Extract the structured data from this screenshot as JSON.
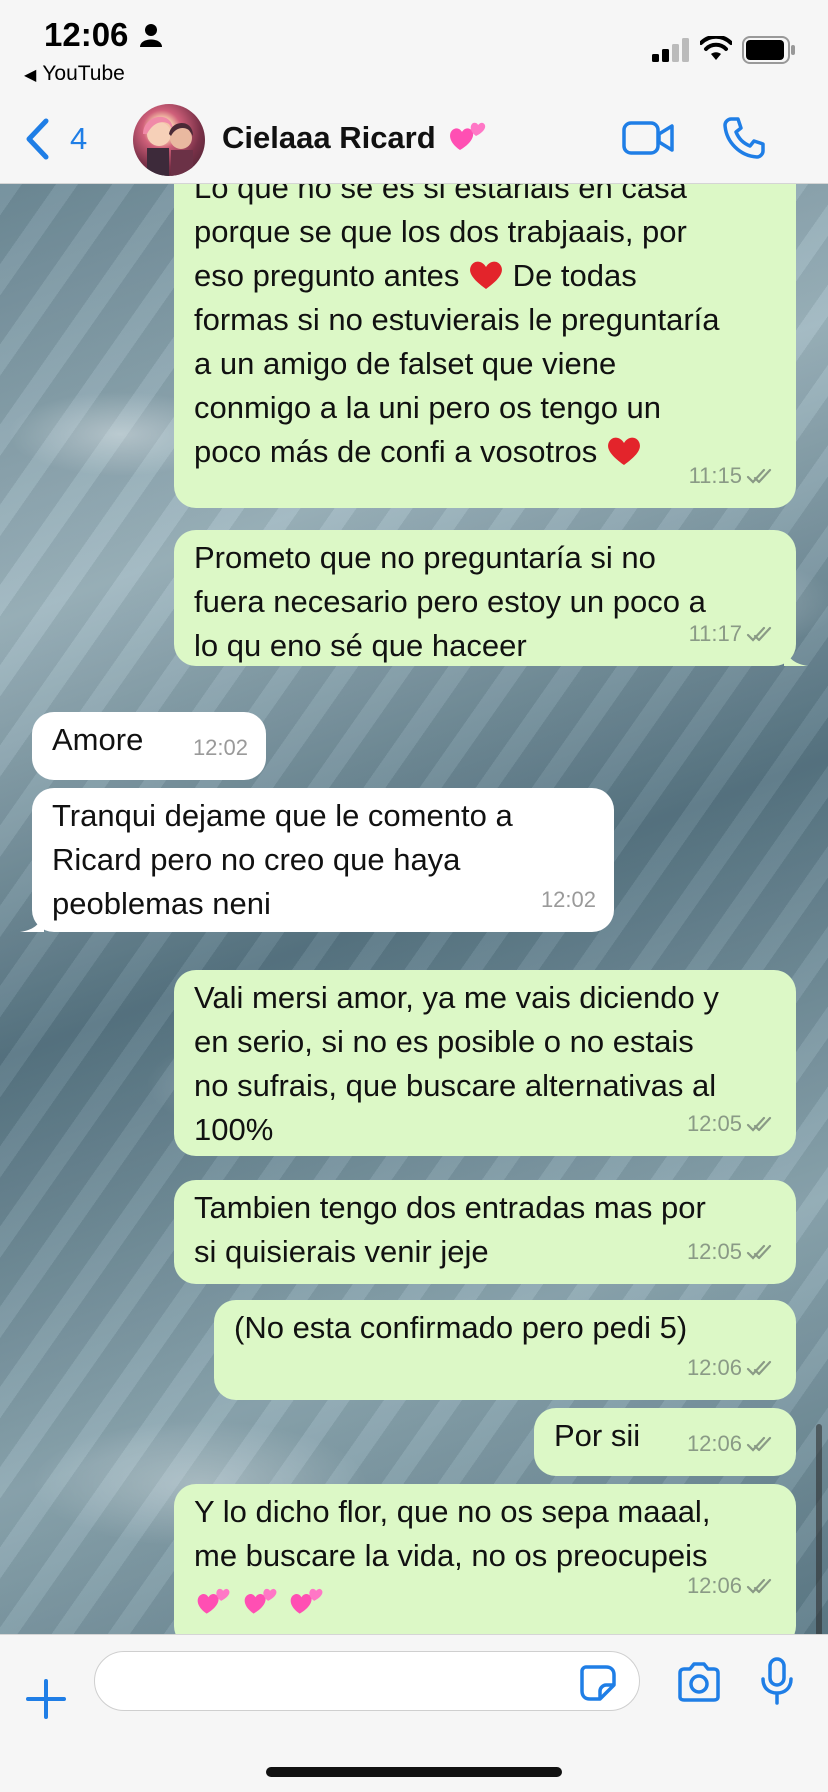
{
  "status_bar": {
    "time": "12:06",
    "back_app": "YouTube",
    "icons": [
      "person-icon",
      "signal-icon",
      "wifi-icon",
      "battery-icon"
    ]
  },
  "header": {
    "back_count": "4",
    "contact_name": "Cielaaa Ricard",
    "contact_emoji": "two-hearts-emoji",
    "icons": [
      "back-chevron-icon",
      "video-call-icon",
      "phone-call-icon"
    ],
    "accent_color": "#1f7ee6"
  },
  "messages": [
    {
      "dir": "out",
      "text": "Lo que no se es si estariais en casa\nporque se que los dos trabjaais, por\neso pregunto antes",
      "text2": " De todas\nformas si no estuvierais le preguntaría\na un amigo de falset que viene\nconmigo a la uni pero os tengo un\npoco más de confi a vosotros",
      "time": "11:15"
    },
    {
      "dir": "out",
      "text": "Prometo que no preguntaría si no\nfuera necesario pero estoy un poco a\nlo qu eno sé que haceer",
      "time": "11:17"
    },
    {
      "dir": "in",
      "text": "Amore",
      "time": "12:02"
    },
    {
      "dir": "in",
      "text": "Tranqui dejame que le comento a\nRicard pero no creo que haya\npeoblemas neni",
      "time": "12:02"
    },
    {
      "dir": "out",
      "text": "Vali mersi amor, ya me vais diciendo y\nen serio, si no es posible o no estais\nno sufrais, que buscare alternativas al\n100%",
      "time": "12:05"
    },
    {
      "dir": "out",
      "text": "Tambien tengo dos entradas mas por\nsi quisierais venir jeje",
      "time": "12:05"
    },
    {
      "dir": "out",
      "text": "(No esta confirmado pero pedi 5)",
      "time": "12:06"
    },
    {
      "dir": "out",
      "text": "Por sii",
      "time": "12:06"
    },
    {
      "dir": "out",
      "text": "Y lo dicho flor, que no os sepa maaal,\nme buscare la vida, no os preocupeis",
      "time": "12:06"
    }
  ],
  "colors": {
    "outgoing_bubble": "#dcf8c6",
    "incoming_bubble": "#ffffff",
    "heart": "#e3242b",
    "pink_hearts": "#ff4fb3"
  },
  "input_bar": {
    "placeholder": "",
    "icons": [
      "plus-icon",
      "sticker-icon",
      "camera-icon",
      "microphone-icon"
    ]
  }
}
